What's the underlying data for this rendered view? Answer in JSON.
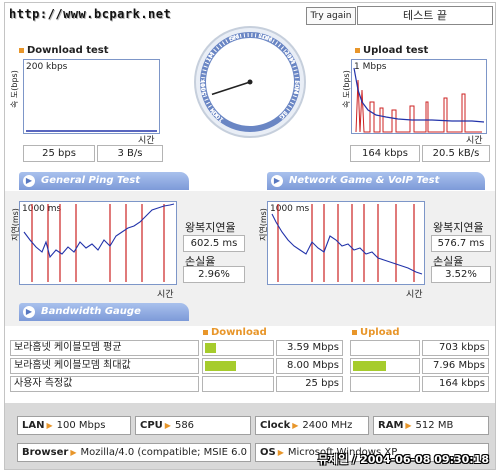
{
  "header": {
    "url": "http://www.bcpark.net",
    "try_again": "Try again",
    "status": "테스트 끝"
  },
  "download": {
    "title": "Download test",
    "y_label": "속 도(bps)",
    "scale": "200 kbps",
    "x_label": "시간",
    "bps": "25 bps",
    "bytes": "3 B/s"
  },
  "upload": {
    "title": "Upload test",
    "y_label": "속 도(bps)",
    "scale": "1 Mbps",
    "x_label": "시간",
    "bps": "164 kbps",
    "bytes": "20.5 kB/s"
  },
  "tabs": {
    "ping": "General Ping Test",
    "game": "Network Game & VoIP Test",
    "bandwidth": "Bandwidth Gauge"
  },
  "ping": {
    "y_label": "지연(ms)",
    "scale": "1000 ms",
    "x_label": "시간",
    "rtt_label": "왕복지연율",
    "rtt": "602.5 ms",
    "loss_label": "손실율",
    "loss": "2.96%"
  },
  "game": {
    "y_label": "지연(ms)",
    "scale": "1000 ms",
    "x_label": "시간",
    "rtt_label": "왕복지연율",
    "rtt": "576.7 ms",
    "loss_label": "손실율",
    "loss": "3.52%"
  },
  "gauge": {
    "download_header": "Download",
    "upload_header": "Upload",
    "rows": [
      {
        "label": "보라홈넷 케이블모뎀 평균",
        "down": "3.59 Mbps",
        "down_pct": 22,
        "up": "703 kbps",
        "up_pct": 5
      },
      {
        "label": "보라홈넷 케이블모뎀 최대값",
        "down": "8.00 Mbps",
        "down_pct": 50,
        "up": "7.96 Mbps",
        "up_pct": 55
      },
      {
        "label": "사용자 측정값",
        "down": "25 bps",
        "down_pct": 0,
        "up": "164 kbps",
        "up_pct": 1
      }
    ]
  },
  "system": {
    "lan_label": "LAN",
    "lan": "100 Mbps",
    "cpu_label": "CPU",
    "cpu": "586",
    "clock_label": "Clock",
    "clock": "2400 MHz",
    "ram_label": "RAM",
    "ram": "512 MB",
    "browser_label": "Browser",
    "browser": "Mozilla/4.0 (compatible; MSIE 6.0",
    "os_label": "OS",
    "os": "Microsoft Windows XP"
  },
  "watermark": "뮤제일 / 2004-06-08 09:30:18",
  "gauge_dial": {
    "ticks": [
      "100k",
      "500k",
      "1M",
      "5M",
      "10M",
      "20M",
      "50M",
      "1G"
    ],
    "needle_pct": 10
  },
  "colors": {
    "accent": "#e8962a",
    "tab": "#7d9ad8",
    "bar": "#a6cc2c",
    "trace_blue": "#2233aa",
    "trace_red": "#cc2222"
  }
}
